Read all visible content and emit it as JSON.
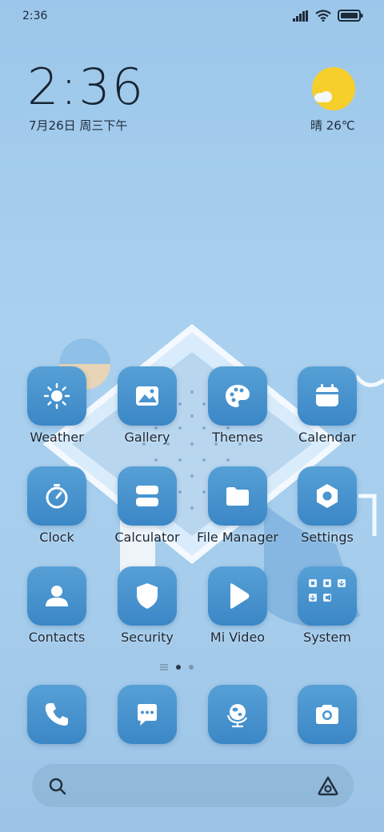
{
  "status_bar": {
    "time": "2:36"
  },
  "clock_widget": {
    "time": "2:36",
    "date": "7月26日 周三下午"
  },
  "weather_widget": {
    "text": "晴 26℃",
    "icon": "sunny-partly-cloudy-icon"
  },
  "apps": [
    {
      "label": "Weather",
      "icon": "weather-sun-icon"
    },
    {
      "label": "Gallery",
      "icon": "gallery-icon"
    },
    {
      "label": "Themes",
      "icon": "palette-icon"
    },
    {
      "label": "Calendar",
      "icon": "calendar-icon"
    },
    {
      "label": "Clock",
      "icon": "stopwatch-icon"
    },
    {
      "label": "Calculator",
      "icon": "calculator-icon"
    },
    {
      "label": "File Manager",
      "icon": "folder-icon"
    },
    {
      "label": "Settings",
      "icon": "settings-hex-icon"
    },
    {
      "label": "Contacts",
      "icon": "person-icon"
    },
    {
      "label": "Security",
      "icon": "shield-icon"
    },
    {
      "label": "Mi Video",
      "icon": "play-icon"
    },
    {
      "label": "System",
      "icon": "folder-grid-icon"
    }
  ],
  "dock": [
    {
      "icon": "phone-icon"
    },
    {
      "icon": "message-icon"
    },
    {
      "icon": "browser-globe-icon"
    },
    {
      "icon": "camera-icon"
    }
  ],
  "page_indicator": {
    "pages": 2,
    "current": 1
  },
  "colors": {
    "tile": "#4a95d0",
    "background": "#a6cdec",
    "sun": "#f7cf2a"
  }
}
